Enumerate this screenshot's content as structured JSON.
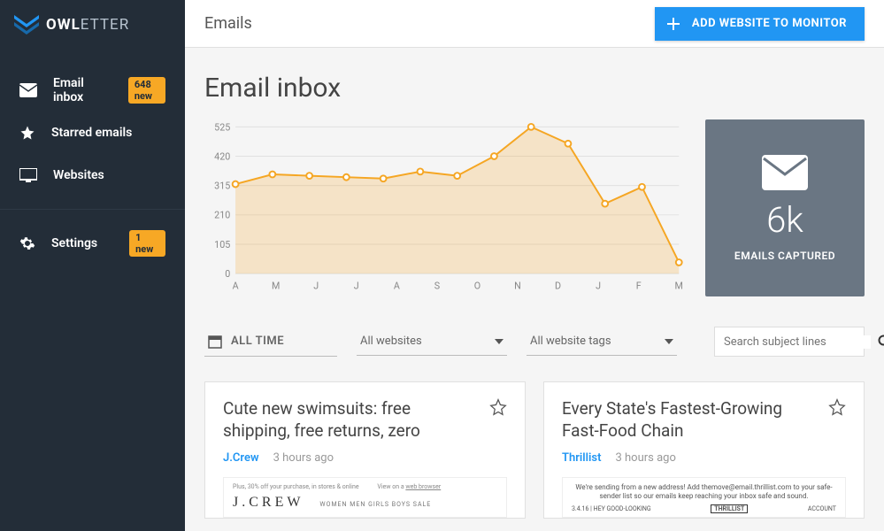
{
  "brand": {
    "name_bold": "OWL",
    "name_light": "ETTER"
  },
  "sidebar": {
    "items": [
      {
        "label": "Email inbox",
        "badge": "648 new"
      },
      {
        "label": "Starred emails"
      },
      {
        "label": "Websites"
      },
      {
        "label": "Settings",
        "badge": "1 new"
      }
    ]
  },
  "topbar": {
    "breadcrumb": "Emails",
    "add_button": "ADD WEBSITE TO MONITOR"
  },
  "page": {
    "title": "Email inbox"
  },
  "stat": {
    "value": "6k",
    "label": "EMAILS CAPTURED"
  },
  "filters": {
    "time": "ALL TIME",
    "websites": "All websites",
    "tags": "All website tags",
    "search_placeholder": "Search subject lines"
  },
  "cards": [
    {
      "title": "Cute new swimsuits: free shipping, free returns, zero",
      "brand": "J.Crew",
      "time": "3 hours ago",
      "preview_logo": "J.CREW",
      "preview_nav": "WOMEN   MEN   GIRLS   BOYS   SALE"
    },
    {
      "title": "Every State's Fastest-Growing Fast-Food Chain",
      "brand": "Thrillist",
      "time": "3 hours ago",
      "preview_text": "We're sending from a new address! Add themove@email.thrillist.com to your safe-sender list so our emails keep reaching your inbox safe and sound.",
      "preview_date": "3.4.16 | HEY GOOD-LOOKING",
      "preview_brand": "THRILLIST",
      "preview_account": "ACCOUNT"
    }
  ],
  "chart_data": {
    "type": "area",
    "categories": [
      "A",
      "M",
      "J",
      "J",
      "A",
      "S",
      "O",
      "N",
      "D",
      "J",
      "F",
      "M"
    ],
    "values": [
      320,
      355,
      350,
      345,
      340,
      365,
      350,
      420,
      525,
      465,
      250,
      310,
      40
    ],
    "ylabel": "",
    "ylim": [
      0,
      525
    ],
    "y_ticks": [
      0,
      105,
      210,
      315,
      420,
      525
    ]
  }
}
